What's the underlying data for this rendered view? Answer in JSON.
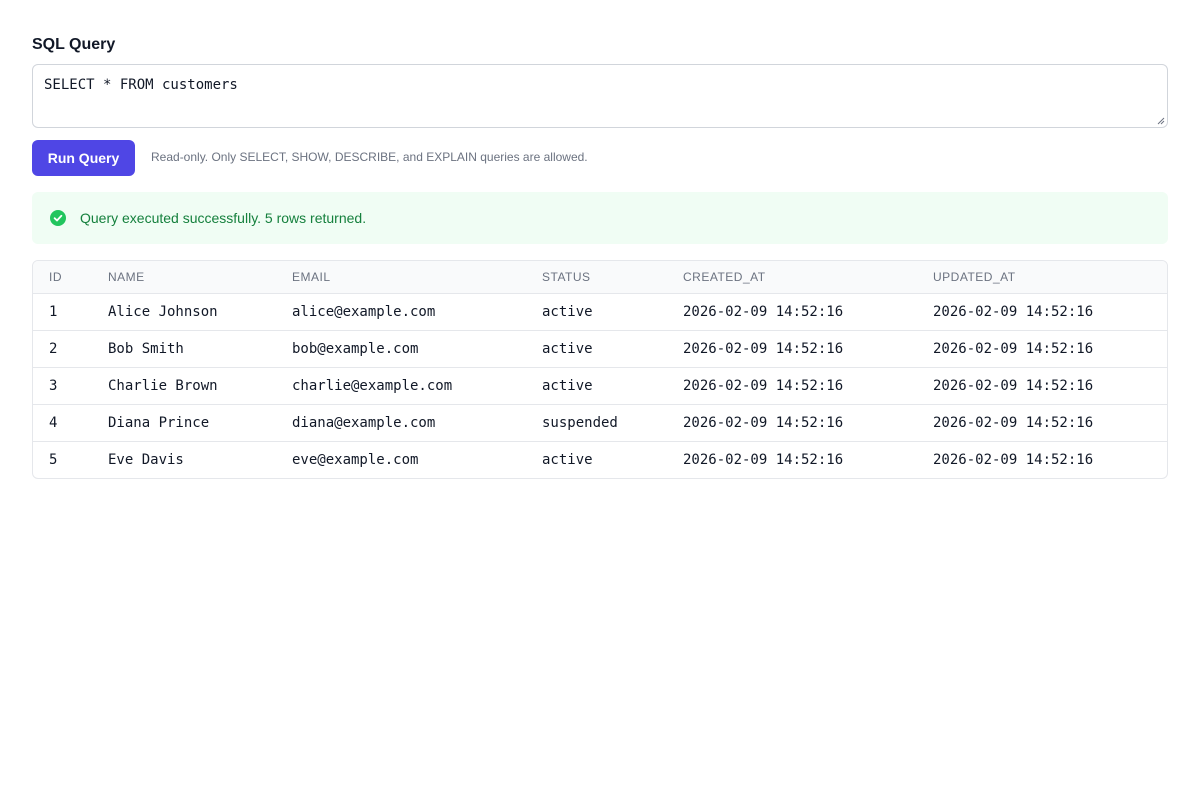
{
  "editor": {
    "label": "SQL Query",
    "query": "SELECT * FROM customers"
  },
  "toolbar": {
    "run_label": "Run Query",
    "hint": "Read-only. Only SELECT, SHOW, DESCRIBE, and EXPLAIN queries are allowed."
  },
  "result": {
    "status_icon": "check-circle-icon",
    "message": "Query executed successfully. 5 rows returned.",
    "success_color": "#22c55e"
  },
  "table": {
    "columns": [
      "ID",
      "NAME",
      "EMAIL",
      "STATUS",
      "CREATED_AT",
      "UPDATED_AT"
    ],
    "rows": [
      [
        "1",
        "Alice Johnson",
        "alice@example.com",
        "active",
        "2026-02-09 14:52:16",
        "2026-02-09 14:52:16"
      ],
      [
        "2",
        "Bob Smith",
        "bob@example.com",
        "active",
        "2026-02-09 14:52:16",
        "2026-02-09 14:52:16"
      ],
      [
        "3",
        "Charlie Brown",
        "charlie@example.com",
        "active",
        "2026-02-09 14:52:16",
        "2026-02-09 14:52:16"
      ],
      [
        "4",
        "Diana Prince",
        "diana@example.com",
        "suspended",
        "2026-02-09 14:52:16",
        "2026-02-09 14:52:16"
      ],
      [
        "5",
        "Eve Davis",
        "eve@example.com",
        "active",
        "2026-02-09 14:52:16",
        "2026-02-09 14:52:16"
      ]
    ]
  },
  "colors": {
    "accent": "#4f46e5",
    "success_bg": "#f0fdf4",
    "success_text": "#15803d"
  }
}
